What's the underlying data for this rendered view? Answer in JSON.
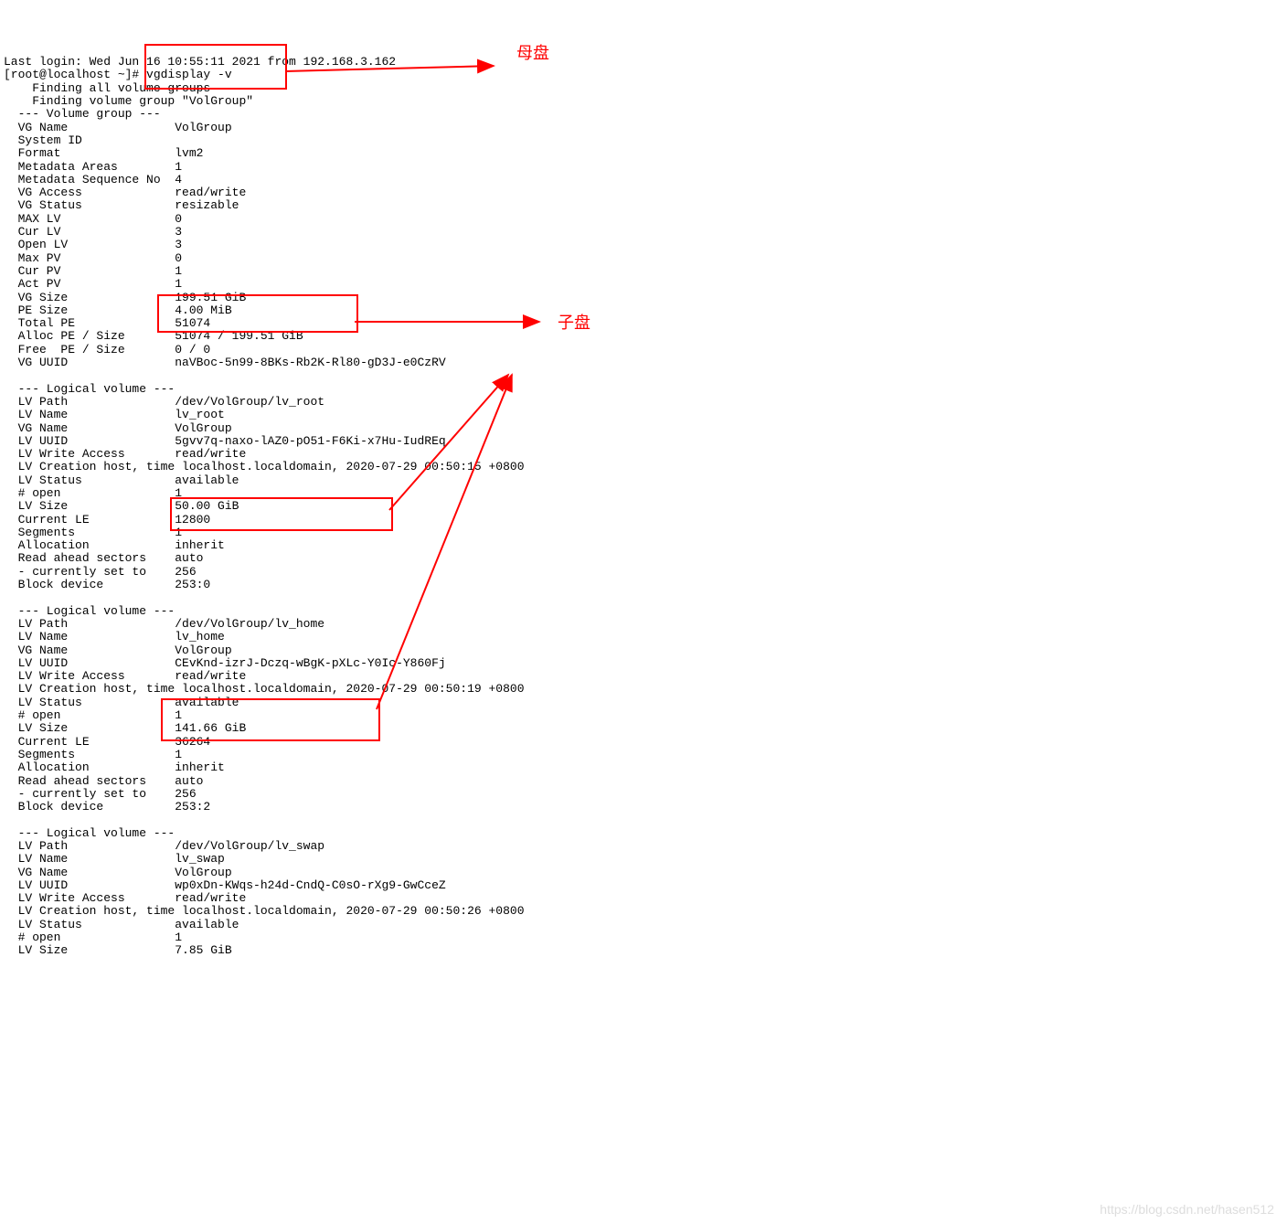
{
  "terminal": {
    "login_line": "Last login: Wed Jun 16 10:55:11 2021 from 192.168.3.162",
    "prompt_line": "[root@localhost ~]# vgdisplay -v",
    "find_all": "    Finding all volume groups",
    "find_vg": "    Finding volume group \"VolGroup\"",
    "vg_header": "  --- Volume group ---",
    "vg_fields": [
      [
        "  VG Name",
        "VolGroup"
      ],
      [
        "  System ID",
        ""
      ],
      [
        "  Format",
        "lvm2"
      ],
      [
        "  Metadata Areas",
        "1"
      ],
      [
        "  Metadata Sequence No",
        "4"
      ],
      [
        "  VG Access",
        "read/write"
      ],
      [
        "  VG Status",
        "resizable"
      ],
      [
        "  MAX LV",
        "0"
      ],
      [
        "  Cur LV",
        "3"
      ],
      [
        "  Open LV",
        "3"
      ],
      [
        "  Max PV",
        "0"
      ],
      [
        "  Cur PV",
        "1"
      ],
      [
        "  Act PV",
        "1"
      ],
      [
        "  VG Size",
        "199.51 GiB"
      ],
      [
        "  PE Size",
        "4.00 MiB"
      ],
      [
        "  Total PE",
        "51074"
      ],
      [
        "  Alloc PE / Size",
        "51074 / 199.51 GiB"
      ],
      [
        "  Free  PE / Size",
        "0 / 0"
      ],
      [
        "  VG UUID",
        "naVBoc-5n99-8BKs-Rb2K-Rl80-gD3J-e0CzRV"
      ]
    ],
    "lv1_header": "  --- Logical volume ---",
    "lv1_fields": [
      [
        "  LV Path",
        "/dev/VolGroup/lv_root"
      ],
      [
        "  LV Name",
        "lv_root"
      ],
      [
        "  VG Name",
        "VolGroup"
      ],
      [
        "  LV UUID",
        "5gvv7q-naxo-lAZ0-pO51-F6Ki-x7Hu-IudREq"
      ],
      [
        "  LV Write Access",
        "read/write"
      ],
      [
        "  LV Creation host, time",
        "localhost.localdomain, 2020-07-29 00:50:15 +0800"
      ],
      [
        "  LV Status",
        "available"
      ],
      [
        "  # open",
        "1"
      ],
      [
        "  LV Size",
        "50.00 GiB"
      ],
      [
        "  Current LE",
        "12800"
      ],
      [
        "  Segments",
        "1"
      ],
      [
        "  Allocation",
        "inherit"
      ],
      [
        "  Read ahead sectors",
        "auto"
      ],
      [
        "  - currently set to",
        "256"
      ],
      [
        "  Block device",
        "253:0"
      ]
    ],
    "lv2_header": "  --- Logical volume ---",
    "lv2_fields": [
      [
        "  LV Path",
        "/dev/VolGroup/lv_home"
      ],
      [
        "  LV Name",
        "lv_home"
      ],
      [
        "  VG Name",
        "VolGroup"
      ],
      [
        "  LV UUID",
        "CEvKnd-izrJ-Dczq-wBgK-pXLc-Y0Ic-Y860Fj"
      ],
      [
        "  LV Write Access",
        "read/write"
      ],
      [
        "  LV Creation host, time",
        "localhost.localdomain, 2020-07-29 00:50:19 +0800"
      ],
      [
        "  LV Status",
        "available"
      ],
      [
        "  # open",
        "1"
      ],
      [
        "  LV Size",
        "141.66 GiB"
      ],
      [
        "  Current LE",
        "36264"
      ],
      [
        "  Segments",
        "1"
      ],
      [
        "  Allocation",
        "inherit"
      ],
      [
        "  Read ahead sectors",
        "auto"
      ],
      [
        "  - currently set to",
        "256"
      ],
      [
        "  Block device",
        "253:2"
      ]
    ],
    "lv3_header": "  --- Logical volume ---",
    "lv3_fields": [
      [
        "  LV Path",
        "/dev/VolGroup/lv_swap"
      ],
      [
        "  LV Name",
        "lv_swap"
      ],
      [
        "  VG Name",
        "VolGroup"
      ],
      [
        "  LV UUID",
        "wp0xDn-KWqs-h24d-CndQ-C0sO-rXg9-GwCceZ"
      ],
      [
        "  LV Write Access",
        "read/write"
      ],
      [
        "  LV Creation host, time",
        "localhost.localdomain, 2020-07-29 00:50:26 +0800"
      ],
      [
        "  LV Status",
        "available"
      ],
      [
        "  # open",
        "1"
      ],
      [
        "  LV Size",
        "7.85 GiB"
      ]
    ]
  },
  "annotations": {
    "label_parent": "母盘",
    "label_child": "子盘"
  },
  "watermark": "https://blog.csdn.net/hasen512"
}
